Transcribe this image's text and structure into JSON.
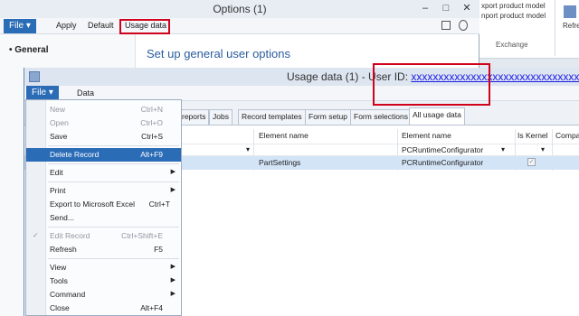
{
  "options_window": {
    "title": "Options (1)",
    "controls": {
      "minimize": "–",
      "maximize": "□",
      "close": "✕"
    },
    "toolbar": {
      "file": "File ▾",
      "apply": "Apply",
      "default": "Default",
      "usage_data": "Usage data"
    },
    "nav": {
      "general": "• General"
    },
    "heading": "Set up general user options"
  },
  "ribbon": {
    "line1": "xport product model",
    "line2": "nport product model",
    "group": "Exchange",
    "right": "Refre"
  },
  "usage_window": {
    "title_prefix": "Usage data (1) - User ID: ",
    "user_id": "xxxxxxxxxxxxxxxxxxxxxxxxxxxxxxxx",
    "controls": {
      "minimize": "–",
      "maximize": "□",
      "close": "✕"
    },
    "toolbar": {
      "file": "File ▾",
      "data": "Data"
    },
    "tabs": [
      "reports",
      "Jobs",
      "Record templates",
      "Form setup",
      "Form selections",
      "All usage data"
    ],
    "grid": {
      "headers": {
        "element_name": "Element name",
        "element_name_2": "Element name",
        "is_kernel": "Is Kernel",
        "company": "Compa"
      },
      "filter": {
        "element_name_2": "PCRuntimeConfigurator"
      },
      "row": {
        "element_name": "PartSettings",
        "element_name_2": "PCRuntimeConfigurator",
        "is_kernel": "✓"
      }
    }
  },
  "file_menu": {
    "items": [
      {
        "label": "New",
        "shortcut": "Ctrl+N"
      },
      {
        "label": "Open",
        "shortcut": "Ctrl+O"
      },
      {
        "label": "Save",
        "shortcut": "Ctrl+S"
      },
      {
        "label": "Delete Record",
        "shortcut": "Alt+F9"
      },
      {
        "label": "Edit",
        "shortcut": ""
      },
      {
        "label": "Print",
        "shortcut": ""
      },
      {
        "label": "Export to Microsoft Excel",
        "shortcut": "Ctrl+T"
      },
      {
        "label": "Send...",
        "shortcut": ""
      },
      {
        "label": "Edit Record",
        "shortcut": "Ctrl+Shift+E"
      },
      {
        "label": "Refresh",
        "shortcut": "F5"
      },
      {
        "label": "View",
        "shortcut": ""
      },
      {
        "label": "Tools",
        "shortcut": ""
      },
      {
        "label": "Command",
        "shortcut": ""
      },
      {
        "label": "Close",
        "shortcut": "Alt+F4"
      }
    ],
    "arrow": "▶",
    "check": "✓",
    "dropdown_arrow": "▾"
  },
  "colors": {
    "accent": "#2b6cb7",
    "highlight_box": "#d0021b",
    "selected_row": "#d3e4f7"
  }
}
